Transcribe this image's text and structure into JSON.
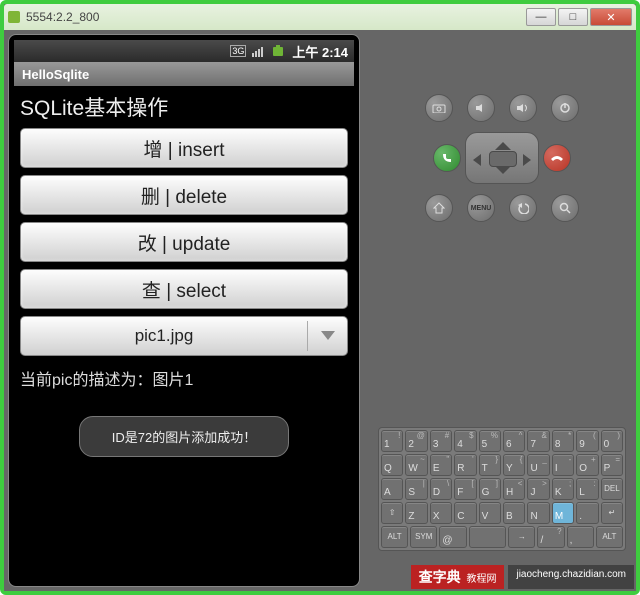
{
  "window": {
    "title": "5554:2.2_800"
  },
  "statusbar": {
    "time_prefix": "上午",
    "time": "2:14"
  },
  "appbar": {
    "title": "HelloSqlite"
  },
  "screen": {
    "heading": "SQLite基本操作",
    "buttons": {
      "insert": "增 | insert",
      "delete": "删 | delete",
      "update": "改 | update",
      "select": "查 | select"
    },
    "spinner_value": "pic1.jpg",
    "description": "当前pic的描述为：图片1",
    "toast": "ID是72的图片添加成功！"
  },
  "hw_labels": {
    "menu": "MENU"
  },
  "keyboard": [
    [
      {
        "m": "1",
        "s": "!"
      },
      {
        "m": "2",
        "s": "@"
      },
      {
        "m": "3",
        "s": "#"
      },
      {
        "m": "4",
        "s": "$"
      },
      {
        "m": "5",
        "s": "%"
      },
      {
        "m": "6",
        "s": "^"
      },
      {
        "m": "7",
        "s": "&"
      },
      {
        "m": "8",
        "s": "*"
      },
      {
        "m": "9",
        "s": "("
      },
      {
        "m": "0",
        "s": ")"
      }
    ],
    [
      {
        "m": "Q"
      },
      {
        "m": "W",
        "s": "~"
      },
      {
        "m": "E",
        "s": "\""
      },
      {
        "m": "R",
        "s": "'"
      },
      {
        "m": "T",
        "s": "}"
      },
      {
        "m": "Y",
        "s": "{"
      },
      {
        "m": "U",
        "s": "_"
      },
      {
        "m": "I",
        "s": "-"
      },
      {
        "m": "O",
        "s": "+"
      },
      {
        "m": "P",
        "s": "="
      }
    ],
    [
      {
        "m": "A"
      },
      {
        "m": "S",
        "s": "|"
      },
      {
        "m": "D",
        "s": "\\"
      },
      {
        "m": "F",
        "s": "["
      },
      {
        "m": "G",
        "s": "]"
      },
      {
        "m": "H",
        "s": "<"
      },
      {
        "m": "J",
        "s": ">"
      },
      {
        "m": "K",
        "s": ";"
      },
      {
        "m": "L",
        "s": ":"
      },
      {
        "m": "DEL",
        "s": "",
        "cls": "alt"
      }
    ],
    [
      {
        "m": "⇧",
        "cls": "alt"
      },
      {
        "m": "Z"
      },
      {
        "m": "X"
      },
      {
        "m": "C"
      },
      {
        "m": "V"
      },
      {
        "m": "B"
      },
      {
        "m": "N"
      },
      {
        "m": "M",
        "cls": "m"
      },
      {
        "m": "."
      },
      {
        "m": "↵",
        "cls": "alt"
      }
    ],
    [
      {
        "m": "ALT",
        "cls": "alt"
      },
      {
        "m": "SYM",
        "cls": "alt"
      },
      {
        "m": "@"
      },
      {
        "m": "",
        "cls": "wide"
      },
      {
        "m": "→",
        "s": "",
        "cls": "alt"
      },
      {
        "m": "/",
        "s": "?"
      },
      {
        "m": ",",
        "s": ""
      },
      {
        "m": "ALT",
        "cls": "alt"
      }
    ]
  ],
  "watermark": {
    "brand": "查字典",
    "sub": "教程网",
    "url": "jiaocheng.chazidian.com"
  }
}
